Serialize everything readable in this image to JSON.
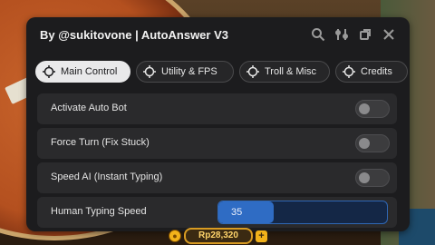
{
  "window": {
    "title": "By @sukitovone | AutoAnswer V3",
    "icons": [
      "search-icon",
      "sliders-icon",
      "minimize-icon",
      "close-icon"
    ]
  },
  "tabs": [
    {
      "label": "Main Control",
      "active": true
    },
    {
      "label": "Utility & FPS",
      "active": false
    },
    {
      "label": "Troll & Misc",
      "active": false
    },
    {
      "label": "Credits",
      "active": false
    }
  ],
  "settings": [
    {
      "label": "Activate Auto Bot",
      "type": "toggle",
      "on": false
    },
    {
      "label": "Force Turn (Fix Stuck)",
      "type": "toggle",
      "on": false
    },
    {
      "label": "Speed AI (Instant Typing)",
      "type": "toggle",
      "on": false
    },
    {
      "label": "Human Typing Speed",
      "type": "slider",
      "value": "35",
      "fill_fraction": 0.33
    }
  ],
  "currency": {
    "amount": "Rp28,320"
  },
  "colors": {
    "accent": "#2f6cc4",
    "panel": "#1c1c1e"
  }
}
